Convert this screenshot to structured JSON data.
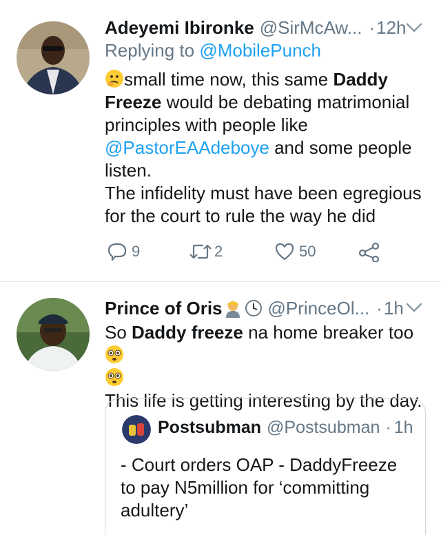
{
  "tweets": [
    {
      "name": "Adeyemi Ibironke",
      "handle": "@SirMcAw...",
      "separator": "·",
      "time": "12h",
      "reply_prefix": "Replying to ",
      "reply_to": "@MobilePunch",
      "text": {
        "p1": "small time now, this same ",
        "b1": "Daddy Freeze",
        "p2": " would be debating matrimonial principles with people like ",
        "mention": "@PastorEAAdeboye",
        "p3": " and some people listen.",
        "p4": "The infidelity must have been egregious for the court to rule the way he did"
      },
      "emoji": "thinking-face-emoji",
      "actions": {
        "replies": "9",
        "retweets": "2",
        "likes": "50"
      }
    },
    {
      "name": "Prince of Oris",
      "name_emojis": [
        "person-emoji",
        "clock-emoji"
      ],
      "handle": "@PrinceOl...",
      "separator": "·",
      "time": "1h",
      "text": {
        "p1": "So ",
        "b1": "Daddy freeze",
        "p2": " na home breaker too",
        "p3": "This life is getting interesting by the day."
      },
      "emoji": "flushed-face-emoji",
      "quote": {
        "name": "Postsubman",
        "handle": "@Postsubman",
        "separator": "·",
        "time": "1h",
        "text": "- Court orders OAP - DaddyFreeze to pay N5million for ‘committing adultery’"
      }
    }
  ],
  "colors": {
    "link": "#1da1f2",
    "secondary": "#657786",
    "divider": "#e1e8ed"
  }
}
